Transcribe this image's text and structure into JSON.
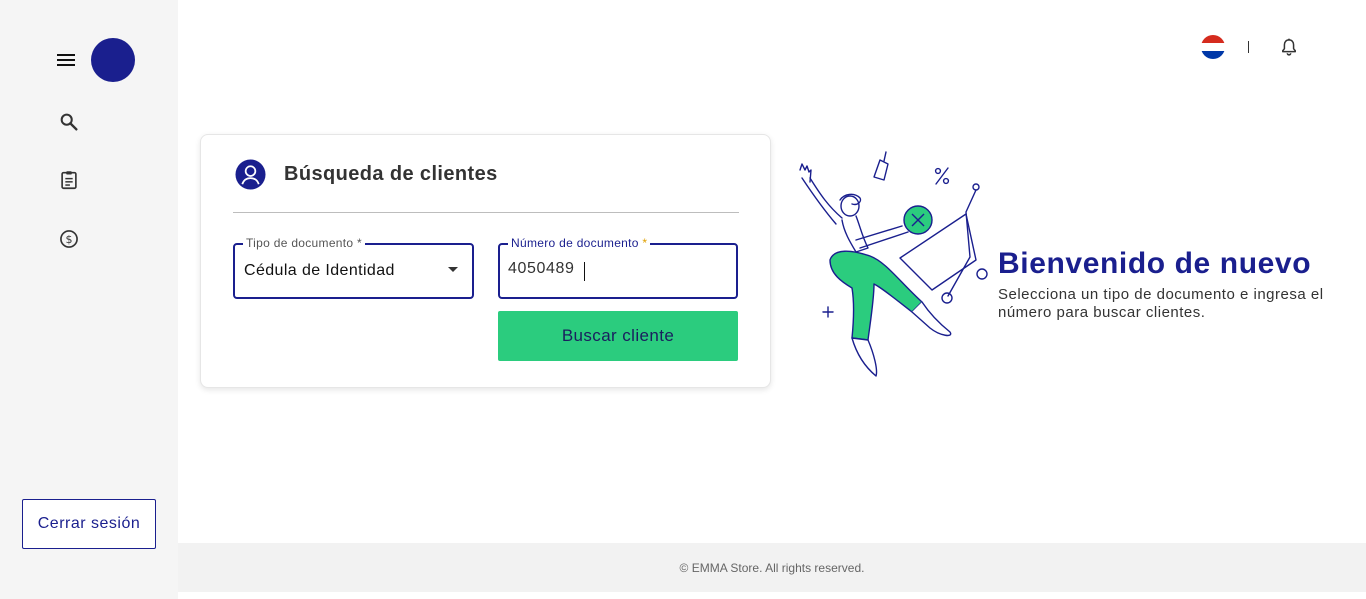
{
  "sidebar": {
    "menu_icon": "menu-icon",
    "items": [
      {
        "icon": "search-icon"
      },
      {
        "icon": "clipboard-icon"
      },
      {
        "icon": "dollar-icon"
      }
    ],
    "logout_label": "Cerrar sesión"
  },
  "header": {
    "flag": "paraguay-flag",
    "notifications_icon": "bell-icon"
  },
  "search_card": {
    "title": "Búsqueda de clientes",
    "doc_type": {
      "label": "Tipo de documento",
      "required_mark": "*",
      "value": "Cédula de Identidad"
    },
    "doc_number": {
      "label": "Número de documento",
      "required_mark": "*",
      "value": "4050489"
    },
    "search_button": "Buscar cliente"
  },
  "welcome": {
    "title": "Bienvenido de nuevo",
    "subtitle": "Selecciona un tipo de documento e ingresa el número para buscar clientes."
  },
  "footer": {
    "text": "© EMMA Store. All rights reserved."
  },
  "colors": {
    "primary": "#1a1f8e",
    "accent": "#2bcc7e",
    "sidebar_bg": "#f5f5f5",
    "footer_bg": "#f2f2f2"
  }
}
